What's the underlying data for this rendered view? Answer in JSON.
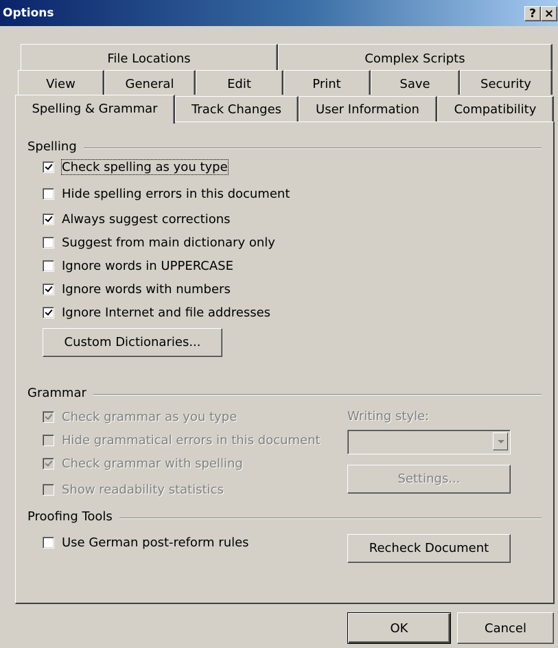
{
  "window": {
    "title": "Options",
    "help_glyph": "?",
    "close_glyph": "×"
  },
  "tabs": {
    "row1": [
      "File Locations",
      "Complex Scripts"
    ],
    "row2": [
      "View",
      "General",
      "Edit",
      "Print",
      "Save",
      "Security"
    ],
    "row3": [
      "Spelling & Grammar",
      "Track Changes",
      "User Information",
      "Compatibility"
    ],
    "active": "Spelling & Grammar"
  },
  "spelling": {
    "label": "Spelling",
    "options": [
      {
        "label": "Check spelling as you type",
        "checked": true
      },
      {
        "label": "Hide spelling errors in this document",
        "checked": false
      },
      {
        "label": "Always suggest corrections",
        "checked": true
      },
      {
        "label": "Suggest from main dictionary only",
        "checked": false
      },
      {
        "label": "Ignore words in UPPERCASE",
        "checked": false
      },
      {
        "label": "Ignore words with numbers",
        "checked": true
      },
      {
        "label": "Ignore Internet and file addresses",
        "checked": true
      }
    ],
    "custom_dictionaries_label": "Custom Dictionaries..."
  },
  "grammar": {
    "label": "Grammar",
    "options": [
      {
        "label": "Check grammar as you type",
        "checked": true,
        "enabled": false
      },
      {
        "label": "Hide grammatical errors in this document",
        "checked": false,
        "enabled": false
      },
      {
        "label": "Check grammar with spelling",
        "checked": true,
        "enabled": false
      },
      {
        "label": "Show readability statistics",
        "checked": false,
        "enabled": false
      }
    ],
    "writing_style_label": "Writing style:",
    "writing_style_value": "",
    "settings_label": "Settings..."
  },
  "proofing": {
    "label": "Proofing Tools",
    "options": [
      {
        "label": "Use German post-reform rules",
        "checked": false
      }
    ],
    "recheck_label": "Recheck Document"
  },
  "footer": {
    "ok_label": "OK",
    "cancel_label": "Cancel"
  }
}
